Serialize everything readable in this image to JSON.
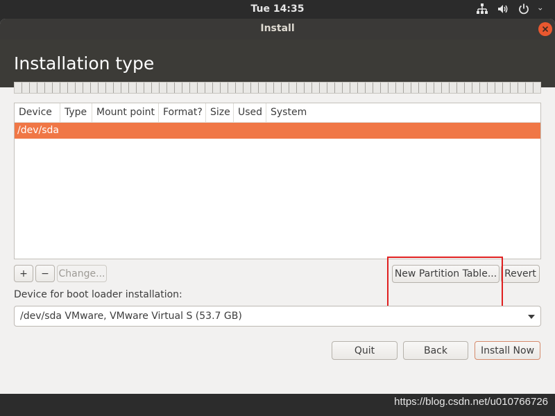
{
  "topbar": {
    "clock": "Tue 14:35",
    "icons": [
      "network-icon",
      "volume-icon",
      "power-icon",
      "chevron-down-icon"
    ]
  },
  "window": {
    "title": "Install",
    "heading": "Installation type"
  },
  "table": {
    "columns": [
      "Device",
      "Type",
      "Mount point",
      "Format?",
      "Size",
      "Used",
      "System"
    ],
    "rows": [
      {
        "device": "/dev/sda",
        "selected": true
      }
    ]
  },
  "partition_buttons": {
    "add": "+",
    "remove": "−",
    "change": "Change...",
    "new_table": "New Partition Table...",
    "revert": "Revert"
  },
  "bootloader": {
    "label": "Device for boot loader installation:",
    "selected": "/dev/sda VMware, VMware Virtual S (53.7 GB)"
  },
  "actions": {
    "quit": "Quit",
    "back": "Back",
    "install": "Install Now"
  },
  "colors": {
    "accent": "#f07746",
    "highlight_box": "#e01f1f"
  },
  "watermark": "https://blog.csdn.net/u010766726"
}
